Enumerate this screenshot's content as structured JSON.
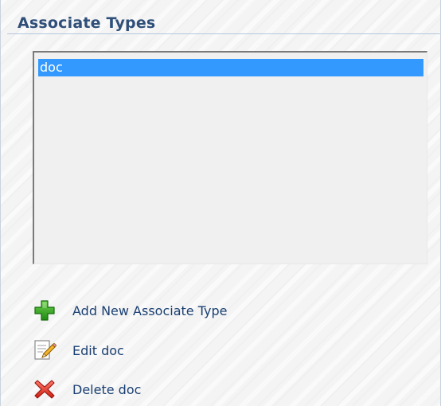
{
  "panel": {
    "title": "Associate Types"
  },
  "associate_types": {
    "items": [
      {
        "label": "doc",
        "selected": true
      }
    ]
  },
  "actions": {
    "add": {
      "label": "Add New Associate Type",
      "icon": "add-icon"
    },
    "edit": {
      "label": "Edit doc",
      "icon": "edit-icon"
    },
    "delete": {
      "label": "Delete doc",
      "icon": "delete-icon"
    }
  },
  "colors": {
    "title": "#2f4f79",
    "selection": "#3399ff",
    "link": "#1a3f72",
    "add_icon": "#2f9e1c",
    "delete_icon": "#e0362c"
  }
}
